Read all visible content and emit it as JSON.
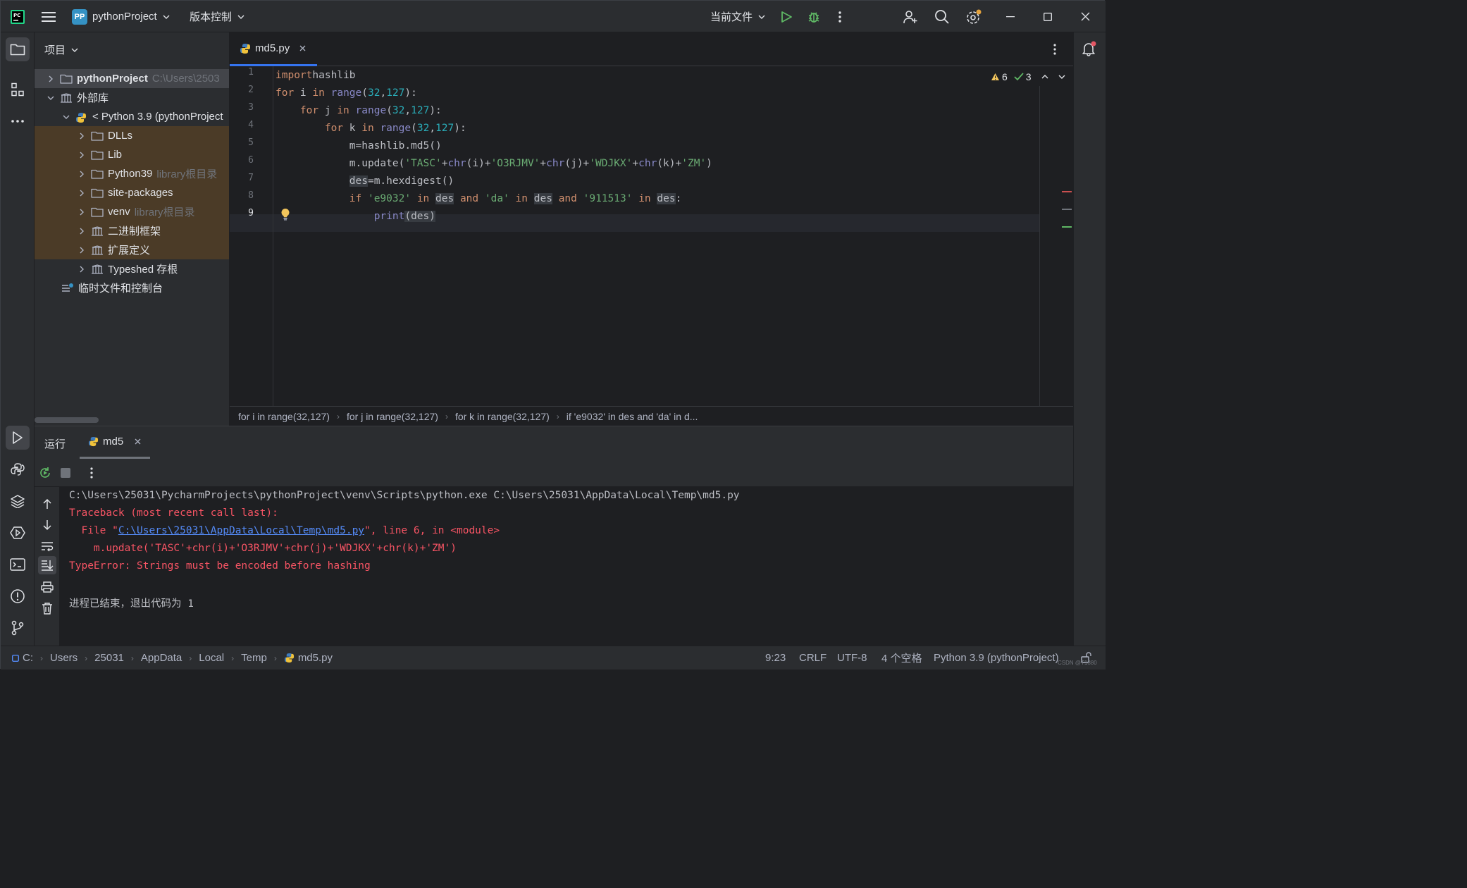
{
  "titlebar": {
    "project_badge": "PP",
    "project_name": "pythonProject",
    "vcs": "版本控制",
    "run_config": "当前文件"
  },
  "project_panel": {
    "title": "项目",
    "root_name": "pythonProject",
    "root_path": "C:\\Users\\2503",
    "external_libs": "外部库",
    "python_sdk": "< Python 3.9 (pythonProject",
    "items": [
      {
        "label": "DLLs",
        "hint": ""
      },
      {
        "label": "Lib",
        "hint": ""
      },
      {
        "label": "Python39",
        "hint": "library根目录"
      },
      {
        "label": "site-packages",
        "hint": ""
      },
      {
        "label": "venv",
        "hint": "library根目录"
      },
      {
        "label": "二进制框架",
        "hint": ""
      },
      {
        "label": "扩展定义",
        "hint": ""
      },
      {
        "label": "Typeshed 存根",
        "hint": ""
      }
    ],
    "scratches": "临时文件和控制台"
  },
  "editor": {
    "tab_name": "md5.py",
    "warnings": "6",
    "checks": "3",
    "line_numbers": [
      "1",
      "2",
      "3",
      "4",
      "5",
      "6",
      "7",
      "8",
      "9"
    ],
    "breadcrumbs": [
      "for i in range(32,127)",
      "for j in range(32,127)",
      "for k in range(32,127)",
      "if 'e9032' in des and 'da' in d..."
    ]
  },
  "run": {
    "title": "运行",
    "tab": "md5",
    "output": {
      "cmd": "C:\\Users\\25031\\PycharmProjects\\pythonProject\\venv\\Scripts\\python.exe C:\\Users\\25031\\AppData\\Local\\Temp\\md5.py",
      "traceback": "Traceback (most recent call last):",
      "file_prefix": "  File \"",
      "file_link": "C:\\Users\\25031\\AppData\\Local\\Temp\\md5.py",
      "file_suffix": "\", line 6, in <module>",
      "code": "    m.update('TASC'+chr(i)+'O3RJMV'+chr(j)+'WDJKX'+chr(k)+'ZM')",
      "error": "TypeError: Strings must be encoded before hashing",
      "exit": "进程已结束，退出代码为 1"
    }
  },
  "statusbar": {
    "path": [
      "C:",
      "Users",
      "25031",
      "AppData",
      "Local",
      "Temp",
      "md5.py"
    ],
    "position": "9:23",
    "line_sep": "CRLF",
    "encoding": "UTF-8",
    "indent": "4 个空格",
    "interpreter": "Python 3.9 (pythonProject)",
    "watermark": "CSDN @T1880"
  }
}
